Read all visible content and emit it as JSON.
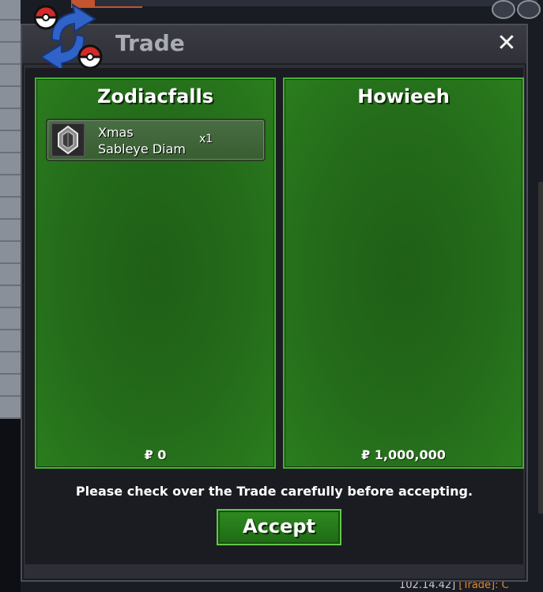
{
  "window": {
    "title": "Trade",
    "close_label": "✕"
  },
  "left_panel": {
    "player_name": "Zodiacfalls",
    "money": "₽ 0",
    "items": [
      {
        "name": "Xmas Sableye Diam",
        "name_line1": "Xmas",
        "name_line2": "Sableye Diam",
        "quantity": "x1",
        "icon": "gem-icon"
      }
    ]
  },
  "right_panel": {
    "player_name": "Howieeh",
    "money": "₽ 1,000,000",
    "items": []
  },
  "notice": "Please check over the Trade carefully before accepting.",
  "accept_label": "Accept",
  "background": {
    "chat_snippet_a": "102.14.42]",
    "chat_snippet_b": "[Trade]: C"
  },
  "colors": {
    "panel_green": "#246b1a",
    "panel_border": "#48b032",
    "accept_green": "#2f8a20",
    "window_bg": "#2e2f36"
  }
}
